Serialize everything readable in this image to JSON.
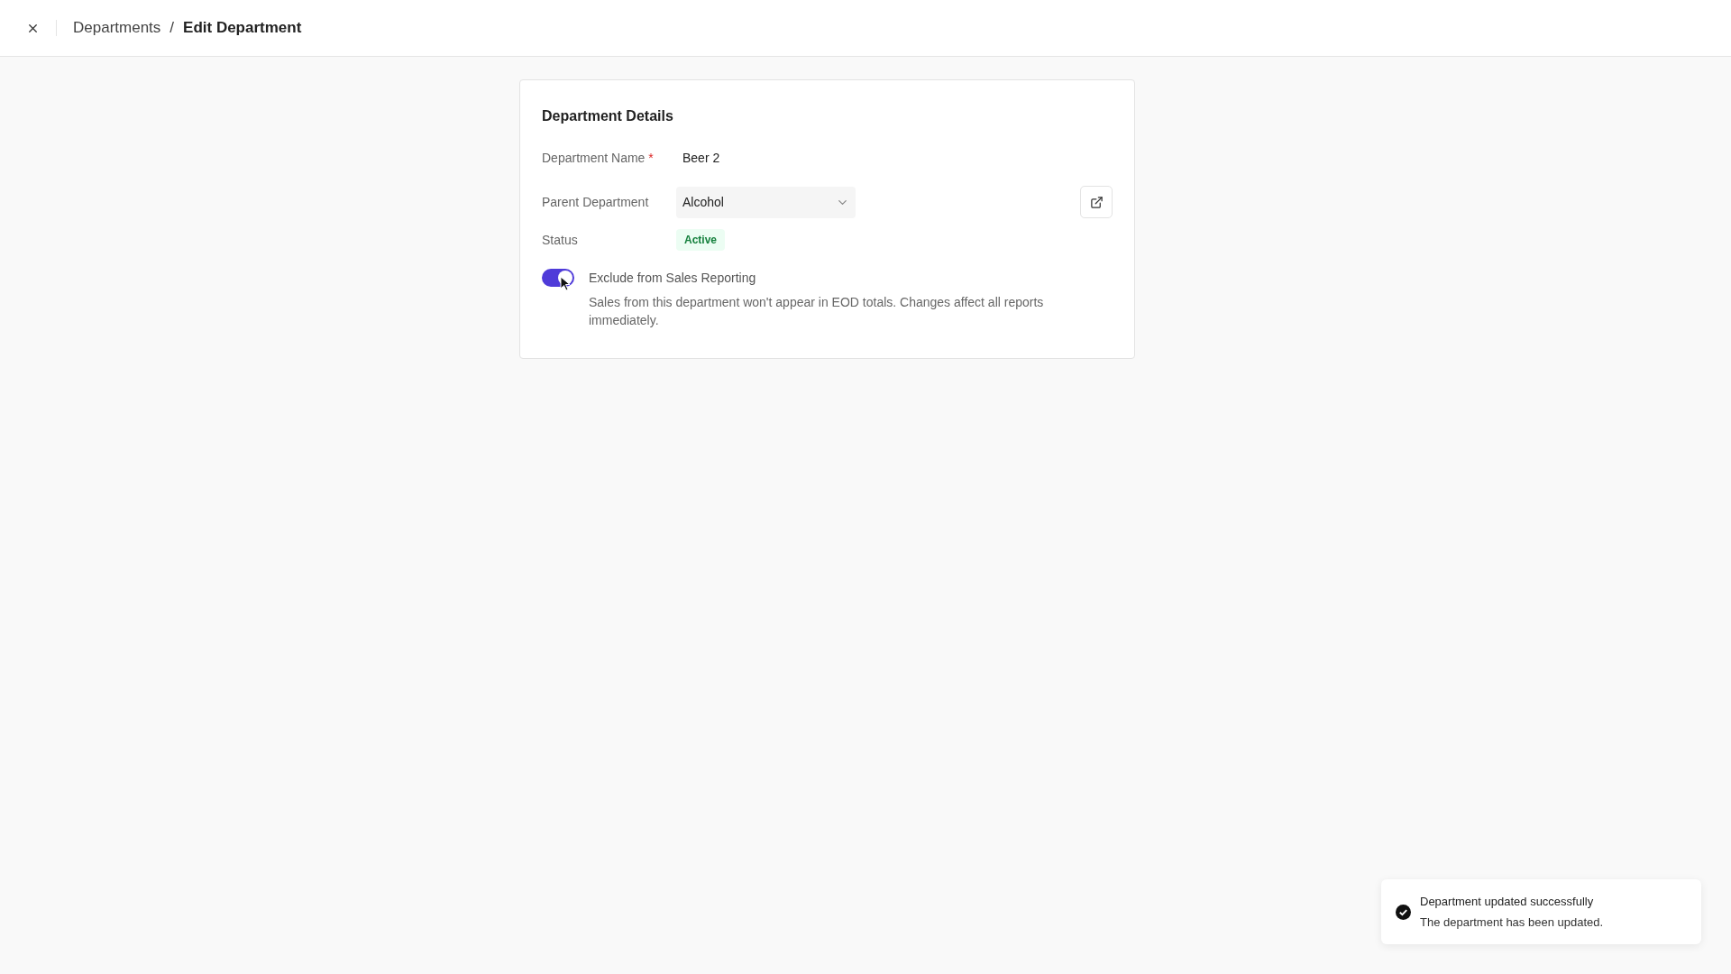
{
  "header": {
    "breadcrumb": [
      "Departments",
      "/",
      "Edit Department"
    ]
  },
  "card": {
    "title": "Department Details",
    "name_field": {
      "label": "Department Name",
      "required_mark": "*",
      "value": "Beer 2"
    },
    "parent_field": {
      "label": "Parent Department",
      "value": "Alcohol"
    },
    "status": {
      "label": "Status",
      "badge": "Active"
    },
    "exclude_toggle": {
      "on": true,
      "label": "Exclude from Sales Reporting",
      "description": "Sales from this department won't appear in EOD totals. Changes affect all reports immediately."
    }
  },
  "toast": {
    "title": "Department updated successfully",
    "message": "The department has been updated."
  }
}
